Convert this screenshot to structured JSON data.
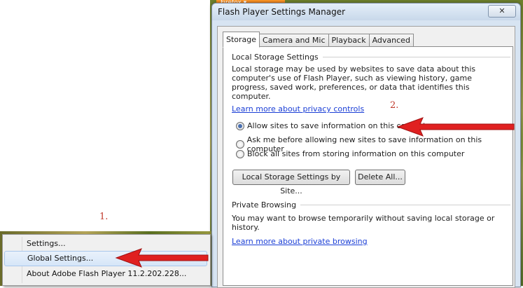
{
  "background": {
    "firefox_tab": "Firefox ▾"
  },
  "annotations": {
    "step1": "1.",
    "step2": "2."
  },
  "window": {
    "title": "Flash Player Settings Manager",
    "close_label": "✕",
    "tabs": [
      "Storage",
      "Camera and Mic",
      "Playback",
      "Advanced"
    ],
    "local_storage": {
      "heading": "Local Storage Settings",
      "description": "Local storage may be used by websites to save data about this computer's use of Flash Player, such as viewing history, game progress, saved work, preferences, or data that identifies this computer.",
      "privacy_link": "Learn more about privacy controls",
      "options": [
        "Allow sites to save information on this computer",
        "Ask me before allowing new sites to save information on this computer",
        "Block all sites from storing information on this computer"
      ],
      "selected_option": 0,
      "settings_by_site_button": "Local Storage Settings by Site...",
      "delete_all_button": "Delete All..."
    },
    "private_browsing": {
      "heading": "Private Browsing",
      "description": "You may want to browse temporarily without saving local storage or history.",
      "link": "Learn more about private browsing"
    }
  },
  "context_menu": {
    "items": [
      "Settings...",
      "Global Settings...",
      "About Adobe Flash Player 11.2.202.228..."
    ],
    "highlighted": 1
  },
  "colors": {
    "arrow": "#e02020",
    "link": "#1a3ed6",
    "annotation": "#c0392b"
  }
}
